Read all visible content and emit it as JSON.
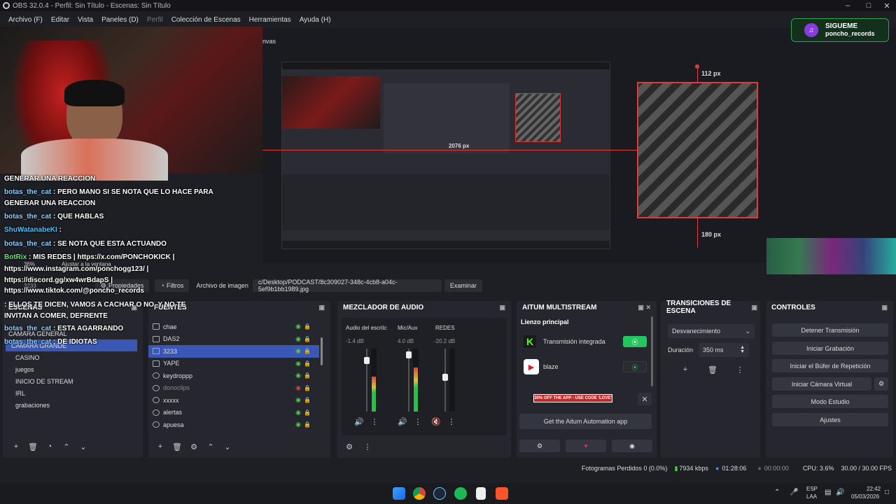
{
  "window": {
    "title": "OBS 32.0.4 - Perfil: Sin Título - Escenas: Sin Título"
  },
  "menu": {
    "items": [
      "Archivo (F)",
      "Editar",
      "Vista",
      "Paneles (D)",
      "Perfil",
      "Colección de Escenas",
      "Herramientas",
      "Ayuda (H)"
    ],
    "dim_index": 4
  },
  "overlay": {
    "follow_title": "SIGUEME",
    "follow_handle": "poncho_records",
    "canvas_tab": "nvas"
  },
  "preview": {
    "width_label": "2076 px",
    "top_label": "112 px",
    "bottom_label": "180 px"
  },
  "chat": [
    {
      "user": "",
      "text": "GENERAR UNA REACCION"
    },
    {
      "user": "botas_the_cat",
      "text": ": PERO MANO SI SE NOTA QUE LO HACE PARA"
    },
    {
      "user": "",
      "text": "GENERAR UNA REACCION"
    },
    {
      "user": "botas_the_cat",
      "text": ": QUE HABLAS"
    },
    {
      "user": "ShuWatanabeKI",
      "text": ":"
    },
    {
      "user": "botas_the_cat",
      "text": ": SE NOTA QUE ESTA ACTUANDO"
    },
    {
      "user": "BotRix",
      "text": ": MIS REDES | https://x.com/PONCHOKICK |"
    },
    {
      "user": "",
      "text": "https://www.instagram.com/ponchogg123/ |"
    },
    {
      "user": "",
      "text": "https://discord.gg/xw4wrBdapS |"
    },
    {
      "user": "",
      "text": "https://www.tiktok.com/@poncho_records"
    },
    {
      "user": "",
      "text": ": ELLOS TE DICEN, VAMOS A CACHAR O NO, Y NO TE"
    },
    {
      "user": "",
      "text": "INVITAN A COMER, DEFRENTE"
    },
    {
      "user": "botas_the_cat",
      "text": ": ESTA AGARRANDO"
    },
    {
      "user": "botas_the_cat",
      "text": ": DE IDIOTAS"
    }
  ],
  "zoom": {
    "value": "36%",
    "fit_label": "Ajustar a la ventana"
  },
  "props_bar": {
    "source_name": "3233",
    "properties": "Propiedades",
    "filters": "Filtros",
    "image_file_label": "Archivo de imagen",
    "file_path": "c/Desktop/PODCAST/8c309027-348c-4cb8-a04c-5ef9b1bb1989.jpg",
    "browse": "Examinar"
  },
  "scenes": {
    "title": "ESCENAS",
    "items": [
      "CAMARA GENERAL",
      "CAMARA GRANDE",
      "CASINO",
      "juegos",
      "INICIO DE STREAM",
      "IRL",
      "grabaciones"
    ],
    "selected": 1
  },
  "sources": {
    "title": "FUENTES",
    "items": [
      {
        "name": "chae",
        "visible": true
      },
      {
        "name": "DAS2",
        "visible": true
      },
      {
        "name": "3233",
        "visible": true
      },
      {
        "name": "YAPE",
        "visible": true
      },
      {
        "name": "keydroppp",
        "visible": true
      },
      {
        "name": "donoclips",
        "visible": false
      },
      {
        "name": "xxxxx",
        "visible": true
      },
      {
        "name": "alertas",
        "visible": true
      },
      {
        "name": "apuesa",
        "visible": true
      }
    ],
    "selected": 2
  },
  "mixer": {
    "title": "MEZCLADOR DE AUDIO",
    "channels": [
      {
        "name": "Audio del escritc",
        "db": "-1.4 dB",
        "level": 0.55,
        "fader": 0.85
      },
      {
        "name": "Mic/Aux",
        "db": "4.0 dB",
        "level": 0.7,
        "fader": 0.95
      },
      {
        "name": "REDES",
        "db": "-20.2 dB",
        "level": 0.0,
        "fader": 0.55,
        "muted": true
      }
    ],
    "scale": [
      "5",
      "0",
      "-5",
      "-10",
      "-15",
      "-20",
      "-25",
      "-30",
      "-35",
      "-40",
      "-45",
      "-50",
      "-55",
      "-60"
    ]
  },
  "aitum": {
    "title": "AITUM MULTISTREAM",
    "canvas_label": "Lienzo principal",
    "outputs": [
      {
        "name": "Transmisión integrada",
        "active": true
      },
      {
        "name": "blaze",
        "active": false
      }
    ],
    "promo": "30% OFF THE APP - USE CODE 'LOVE'",
    "app_button": "Get the Aitum Automation app"
  },
  "transitions": {
    "title": "TRANSICIONES DE ESCENA",
    "selected": "Desvanecimiento",
    "duration_label": "Duración",
    "duration_value": "350 ms"
  },
  "controls": {
    "title": "CONTROLES",
    "buttons": [
      "Detener Transmisión",
      "Iniciar Grabación",
      "Iniciar el Búfer de Repetición",
      "Iniciar Cámara Virtual",
      "Modo Estudio",
      "Ajustes"
    ]
  },
  "status": {
    "dropped": "Fotogramas Perdidos 0 (0.0%)",
    "bitrate": "7934 kbps",
    "stream_time": "01:28:06",
    "rec_time": "00:00:00",
    "cpu": "CPU: 3.6%",
    "fps": "30.00 / 30.00 FPS"
  },
  "taskbar": {
    "lang1": "ESP",
    "lang2": "LAA",
    "time": "22:42",
    "date": "05/03/2026"
  }
}
